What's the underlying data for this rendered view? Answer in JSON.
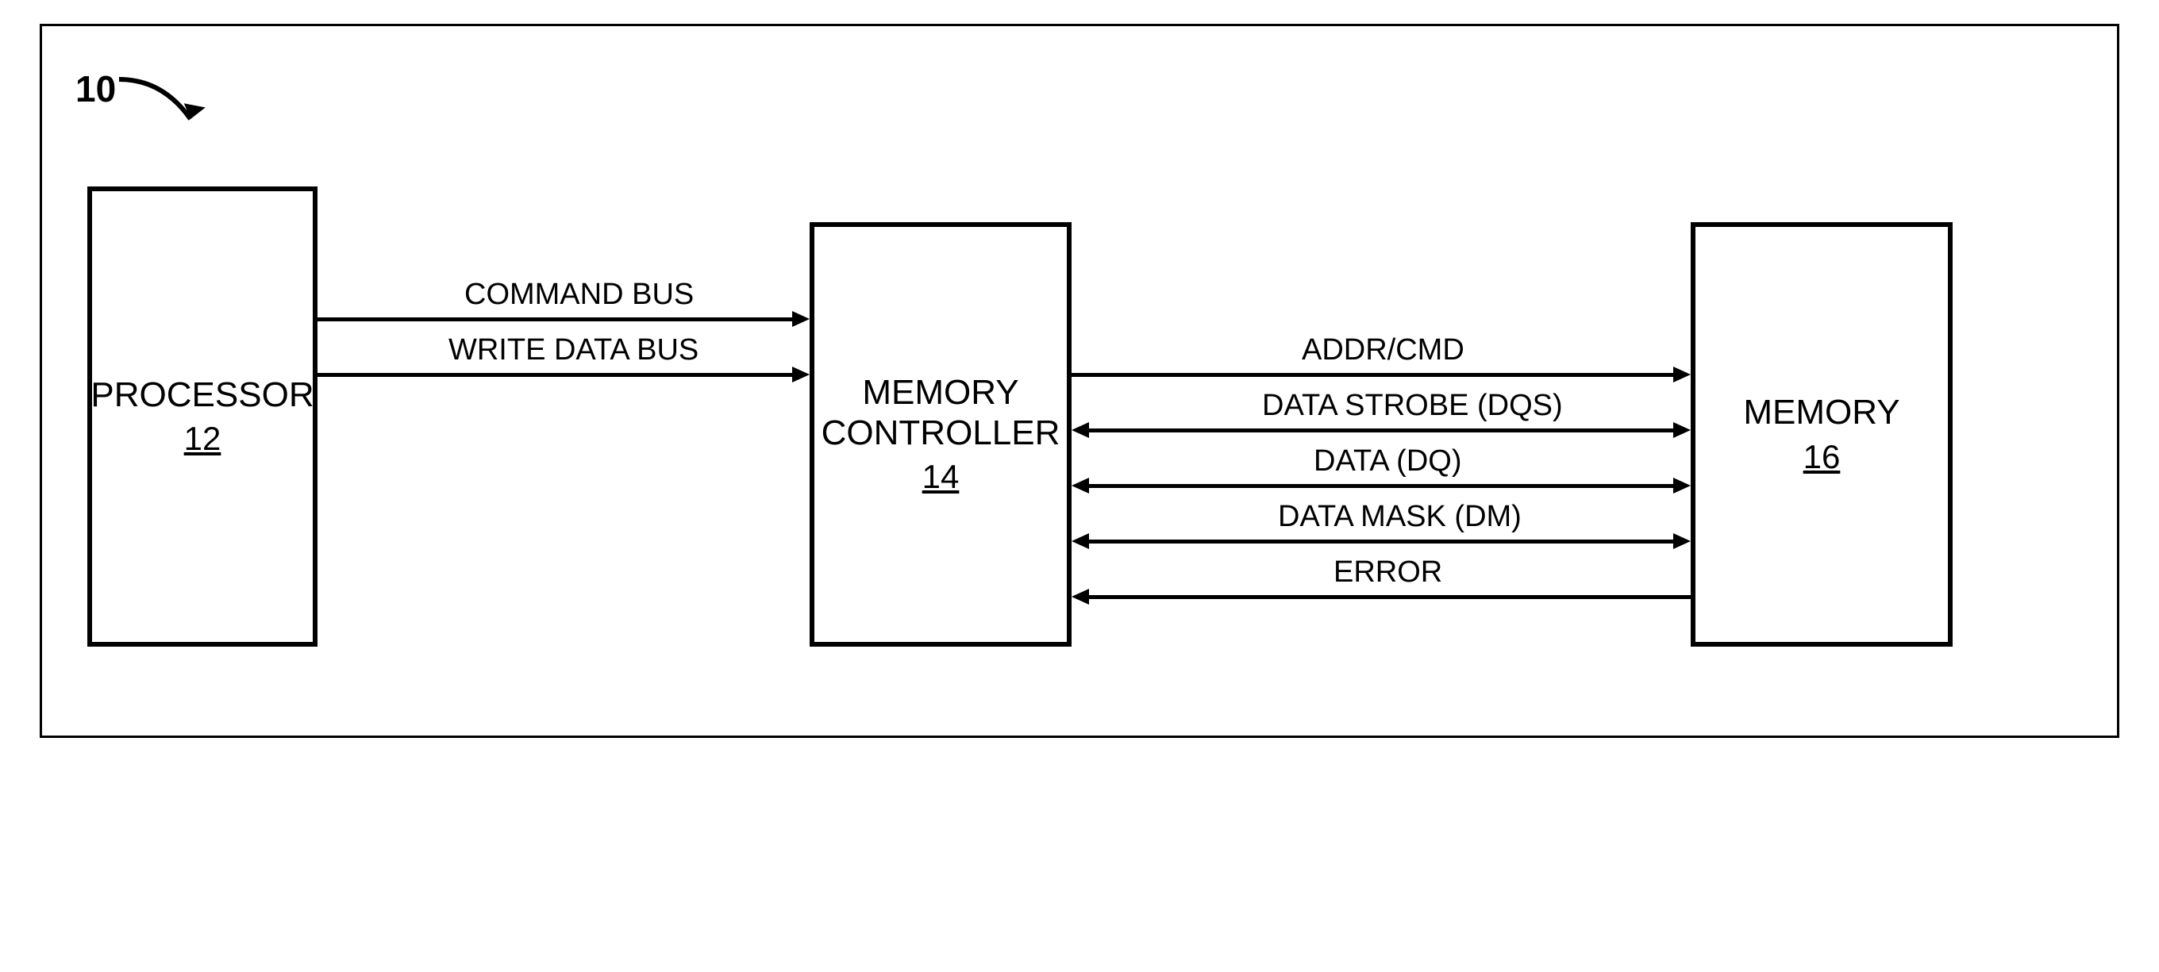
{
  "diagram": {
    "ref_number": "10",
    "blocks": {
      "processor": {
        "title": "PROCESSOR",
        "num": "12"
      },
      "controller": {
        "title": "MEMORY\nCONTROLLER",
        "num": "14"
      },
      "memory": {
        "title": "MEMORY",
        "num": "16"
      }
    },
    "left_buses": {
      "command": "COMMAND BUS",
      "write_data": "WRITE DATA BUS"
    },
    "right_buses": {
      "addr_cmd": "ADDR/CMD",
      "dqs": "DATA STROBE (DQS)",
      "dq": "DATA (DQ)",
      "dm": "DATA MASK (DM)",
      "error": "ERROR"
    }
  }
}
